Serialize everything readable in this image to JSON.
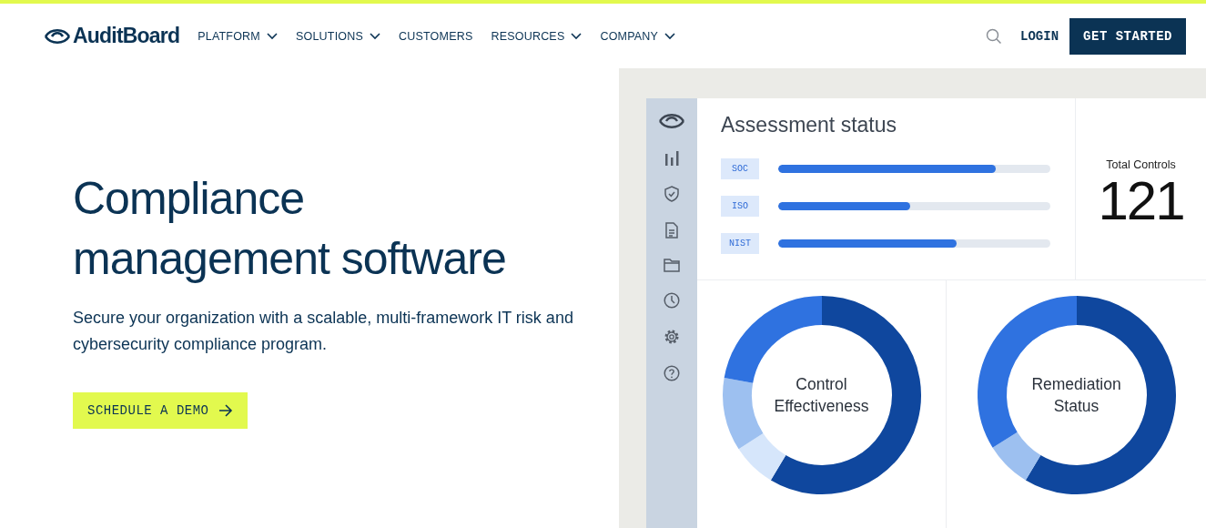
{
  "brand": {
    "name": "AuditBoard"
  },
  "nav": [
    {
      "label": "PLATFORM",
      "dropdown": true
    },
    {
      "label": "SOLUTIONS",
      "dropdown": true
    },
    {
      "label": "CUSTOMERS",
      "dropdown": false
    },
    {
      "label": "RESOURCES",
      "dropdown": true
    },
    {
      "label": "COMPANY",
      "dropdown": true
    }
  ],
  "header_actions": {
    "login": "LOGIN",
    "cta": "GET STARTED"
  },
  "hero": {
    "title_lines": [
      "Compliance",
      "management software"
    ],
    "subtitle": "Secure your organization with a scalable, multi-framework IT risk and cybersecurity compliance program.",
    "button": "SCHEDULE A DEMO"
  },
  "dashboard": {
    "assessment": {
      "title": "Assessment status",
      "rows": [
        {
          "tag": "SOC",
          "level": 0.8
        },
        {
          "tag": "ISO",
          "level": 0.485
        },
        {
          "tag": "NIST",
          "level": 0.655
        }
      ]
    },
    "total": {
      "label": "Total Controls",
      "value": "121"
    },
    "donuts": [
      {
        "label_lines": [
          "Control",
          "Effectiveness"
        ],
        "kind": "effectiveness"
      },
      {
        "label_lines": [
          "Remediation",
          "Status"
        ],
        "kind": "remediation"
      }
    ]
  }
}
